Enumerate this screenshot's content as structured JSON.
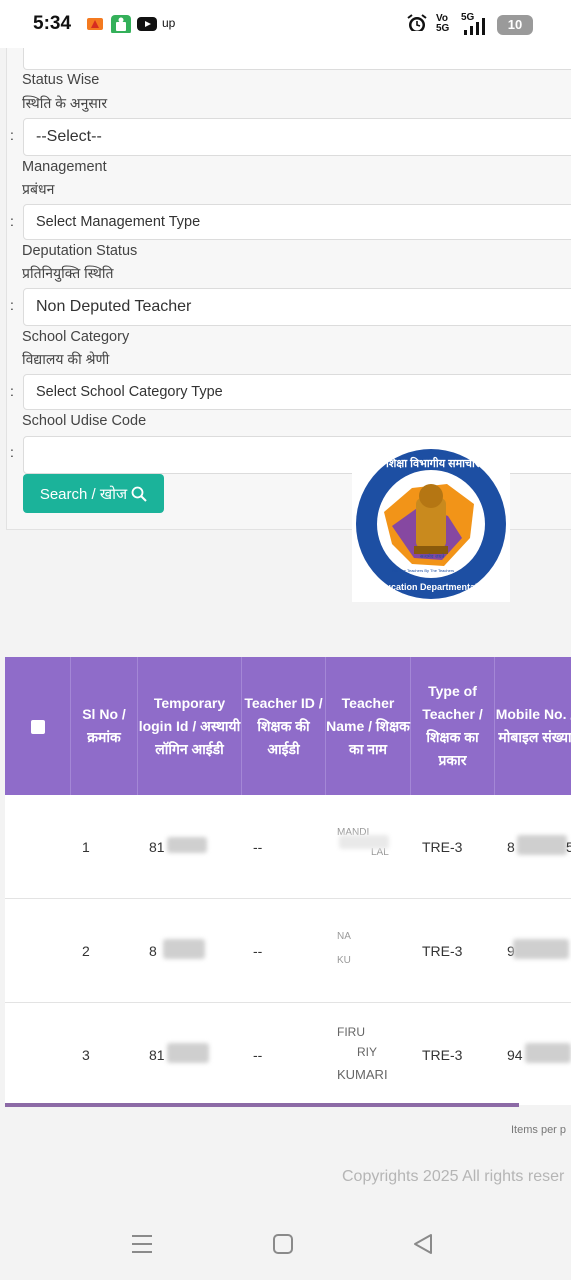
{
  "status_bar": {
    "time": "5:34",
    "left_icons": [
      "flame-app-icon",
      "android-app-icon",
      "youtube-icon",
      "up-icon"
    ],
    "up_label": "up",
    "right_icons": [
      "alarm-icon",
      "volte-icon",
      "signal-5g-icon",
      "battery-icon"
    ],
    "vo_label": "Vo",
    "network_label": "5G",
    "battery_level": "10"
  },
  "form": {
    "status_wise": {
      "label_en": "Status Wise",
      "label_hi": "स्थिति के अनुसार",
      "value": "--Select--"
    },
    "management": {
      "label_en": "Management",
      "label_hi": "प्रबंधन",
      "value": "Select Management Type"
    },
    "deputation": {
      "label_en": "Deputation Status",
      "label_hi": "प्रतिनियुक्ति स्थिति",
      "value": "Non Deputed Teacher"
    },
    "school_category": {
      "label_en": "School Category",
      "label_hi": "विद्यालय की श्रेणी",
      "value": "Select School Category Type"
    },
    "udise": {
      "label_en": "School Udise Code",
      "value": ""
    },
    "colon": ":",
    "search_label": "Search / खोज"
  },
  "logo": {
    "top_text": "शिक्षा विभागीय समाचार",
    "bottom_text": "Education Departmental News",
    "tagline": "For The Teachers By The Teachers",
    "motto": "सत्यमेव जयते"
  },
  "table": {
    "headers": [
      "Sl No / क्रमांक",
      "Temporary login Id / अस्थायी लॉगिन आईडी",
      "Teacher ID / शिक्षक की आईडी",
      "Teacher Name / शिक्षक का नाम",
      "Type of Teacher / शिक्षक का प्रकार",
      "Mobile No. / मोबाइल संख्या"
    ],
    "rows": [
      {
        "sl": "1",
        "login": "81",
        "teacher_id": "--",
        "name_a": "MANDI",
        "name_b": "LAL",
        "type": "TRE-3",
        "mobile": "8",
        "mobile_end": "5"
      },
      {
        "sl": "2",
        "login": "8",
        "teacher_id": "--",
        "name_a": "NA",
        "name_b": "KU",
        "type": "TRE-3",
        "mobile": "9",
        "mobile_end": ""
      },
      {
        "sl": "3",
        "login": "81",
        "teacher_id": "--",
        "name_a": "FIRU",
        "name_b": "RIY",
        "name_c": "KUMARI",
        "type": "TRE-3",
        "mobile": "94",
        "mobile_end": ""
      }
    ]
  },
  "footer": {
    "items_per_page": "Items per p",
    "copyright": "Copyrights 2025 All rights reser"
  },
  "colors": {
    "accent": "#1bb39a",
    "table_header": "#8f6cc9",
    "scrollbar": "#8c6aa6"
  }
}
